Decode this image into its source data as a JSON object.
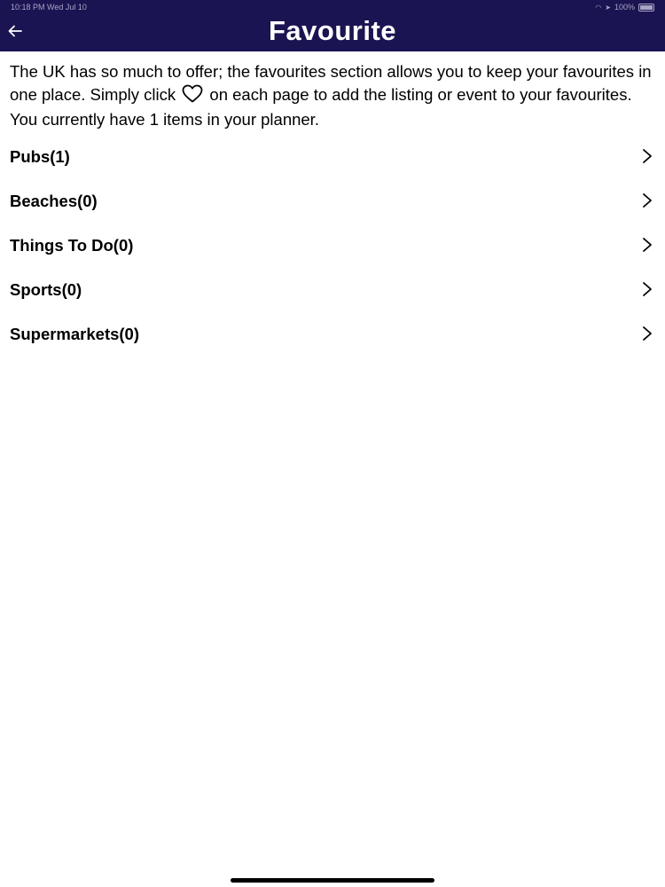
{
  "status_bar": {
    "time_date": "10:18 PM  Wed Jul 10",
    "battery": "100%"
  },
  "header": {
    "title": "Favourite",
    "back_icon": "arrow-left-icon",
    "background_color": "#1b1452"
  },
  "intro": {
    "text_before_icon": "The UK has so much to offer; the favourites section allows you to keep your favourites in one place. Simply click",
    "icon": "heart-outline-icon",
    "text_after_icon": "on each page to add the listing or event to your favourites.",
    "count_text": "You currently have 1 items in your planner."
  },
  "categories": [
    {
      "label": "Pubs(1)",
      "icon": "chevron-right-icon"
    },
    {
      "label": "Beaches(0)",
      "icon": "chevron-right-icon"
    },
    {
      "label": "Things To Do(0)",
      "icon": "chevron-right-icon"
    },
    {
      "label": "Sports(0)",
      "icon": "chevron-right-icon"
    },
    {
      "label": "Supermarkets(0)",
      "icon": "chevron-right-icon"
    }
  ]
}
